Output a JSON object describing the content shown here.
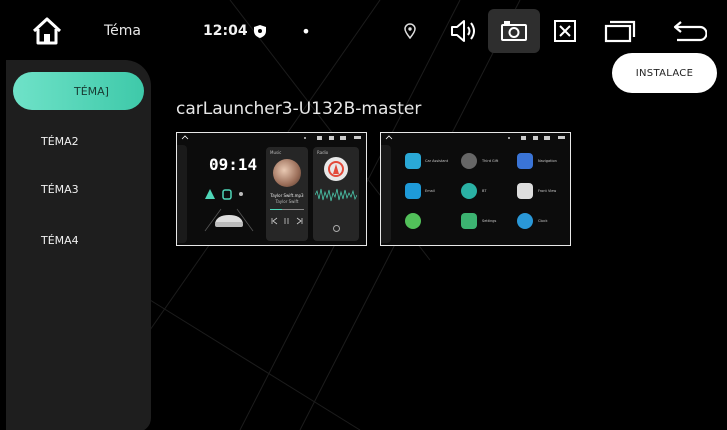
{
  "status_bar": {
    "title": "Téma",
    "time": "12:04",
    "dot": "•",
    "icons": [
      "home-icon",
      "shield-icon",
      "location-pin-icon",
      "volume-icon",
      "screenshot-camera-icon",
      "close-box-icon",
      "recents-icon",
      "back-arrow-icon"
    ]
  },
  "sidebar": {
    "items": [
      {
        "label": "TÉMA]",
        "selected": true
      },
      {
        "label": "TÉMA2",
        "selected": false
      },
      {
        "label": "TÉMA3",
        "selected": false
      },
      {
        "label": "TÉMA4",
        "selected": false
      }
    ]
  },
  "install_button": {
    "label": "INSTALACE"
  },
  "theme": {
    "name": "carLauncher3-U132B-master",
    "preview1": {
      "clock": "09:14",
      "music_label": "Music",
      "radio_label": "Radio",
      "song": "Taylor Swift.mp3",
      "artist": "Taylor Swift"
    },
    "preview2": {
      "apps": [
        "Car Assistant",
        "Third Gift",
        "Navigation",
        "Email",
        "BT",
        "Front View",
        "",
        "Settings",
        "Clock"
      ]
    }
  },
  "colors": {
    "accent": "#4fd6b8",
    "background": "#000000",
    "sidebar": "#1e1e1e",
    "button_bg": "#ffffff"
  }
}
